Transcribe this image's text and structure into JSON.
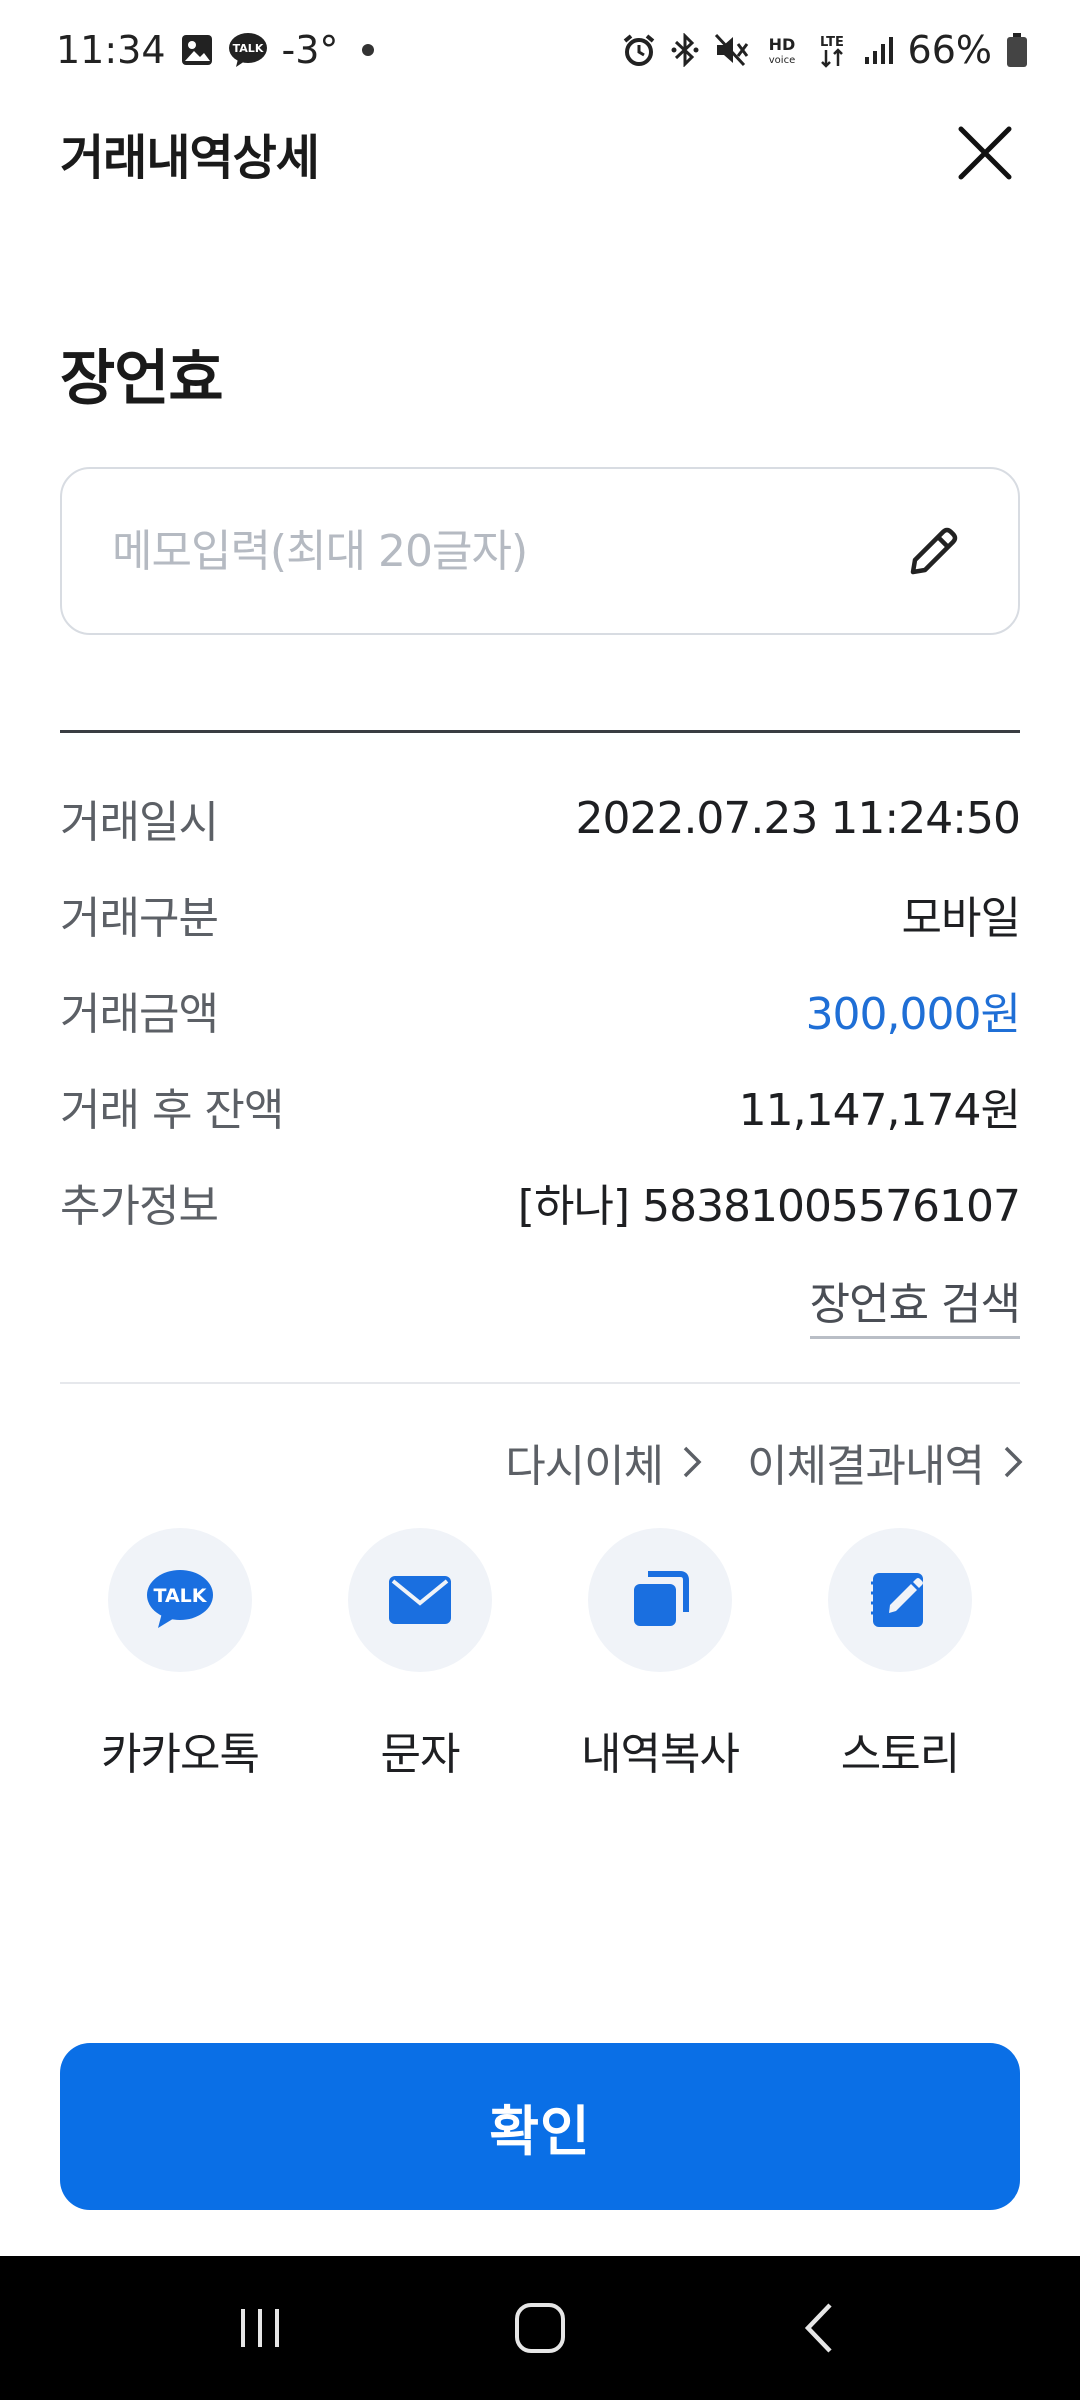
{
  "status_bar": {
    "time": "11:34",
    "temperature": "-3°",
    "battery": "66%",
    "icons": [
      "gallery-icon",
      "talk-icon",
      "alarm-icon",
      "bluetooth-icon",
      "mute-icon",
      "hd-voice-icon",
      "lte-icon",
      "signal-icon",
      "battery-icon"
    ],
    "hd_text": "HD",
    "voice_text": "voice",
    "lte_text": "LTE",
    "talk_text": "TALK"
  },
  "header": {
    "title": "거래내역상세"
  },
  "payee": {
    "name": "장언효"
  },
  "memo": {
    "placeholder": "메모입력(최대 20글자)",
    "value": ""
  },
  "details": [
    {
      "label": "거래일시",
      "value": "2022.07.23 11:24:50"
    },
    {
      "label": "거래구분",
      "value": "모바일"
    },
    {
      "label": "거래금액",
      "value": "300,000원"
    },
    {
      "label": "거래 후 잔액",
      "value": "11,147,174원"
    },
    {
      "label": "추가정보",
      "value": "[하나] 58381005576107"
    }
  ],
  "search_link": "장언효 검색",
  "links": {
    "retransfer": "다시이체",
    "transfer_result": "이체결과내역"
  },
  "share": [
    {
      "label": "카카오톡",
      "icon": "kakaotalk-icon",
      "icon_text": "TALK"
    },
    {
      "label": "문자",
      "icon": "mail-icon"
    },
    {
      "label": "내역복사",
      "icon": "copy-icon"
    },
    {
      "label": "스토리",
      "icon": "story-edit-icon"
    }
  ],
  "confirm_label": "확인",
  "colors": {
    "accent": "#0a6fe6",
    "amount": "#1f6fd6",
    "share_bg": "#f0f3f8"
  }
}
